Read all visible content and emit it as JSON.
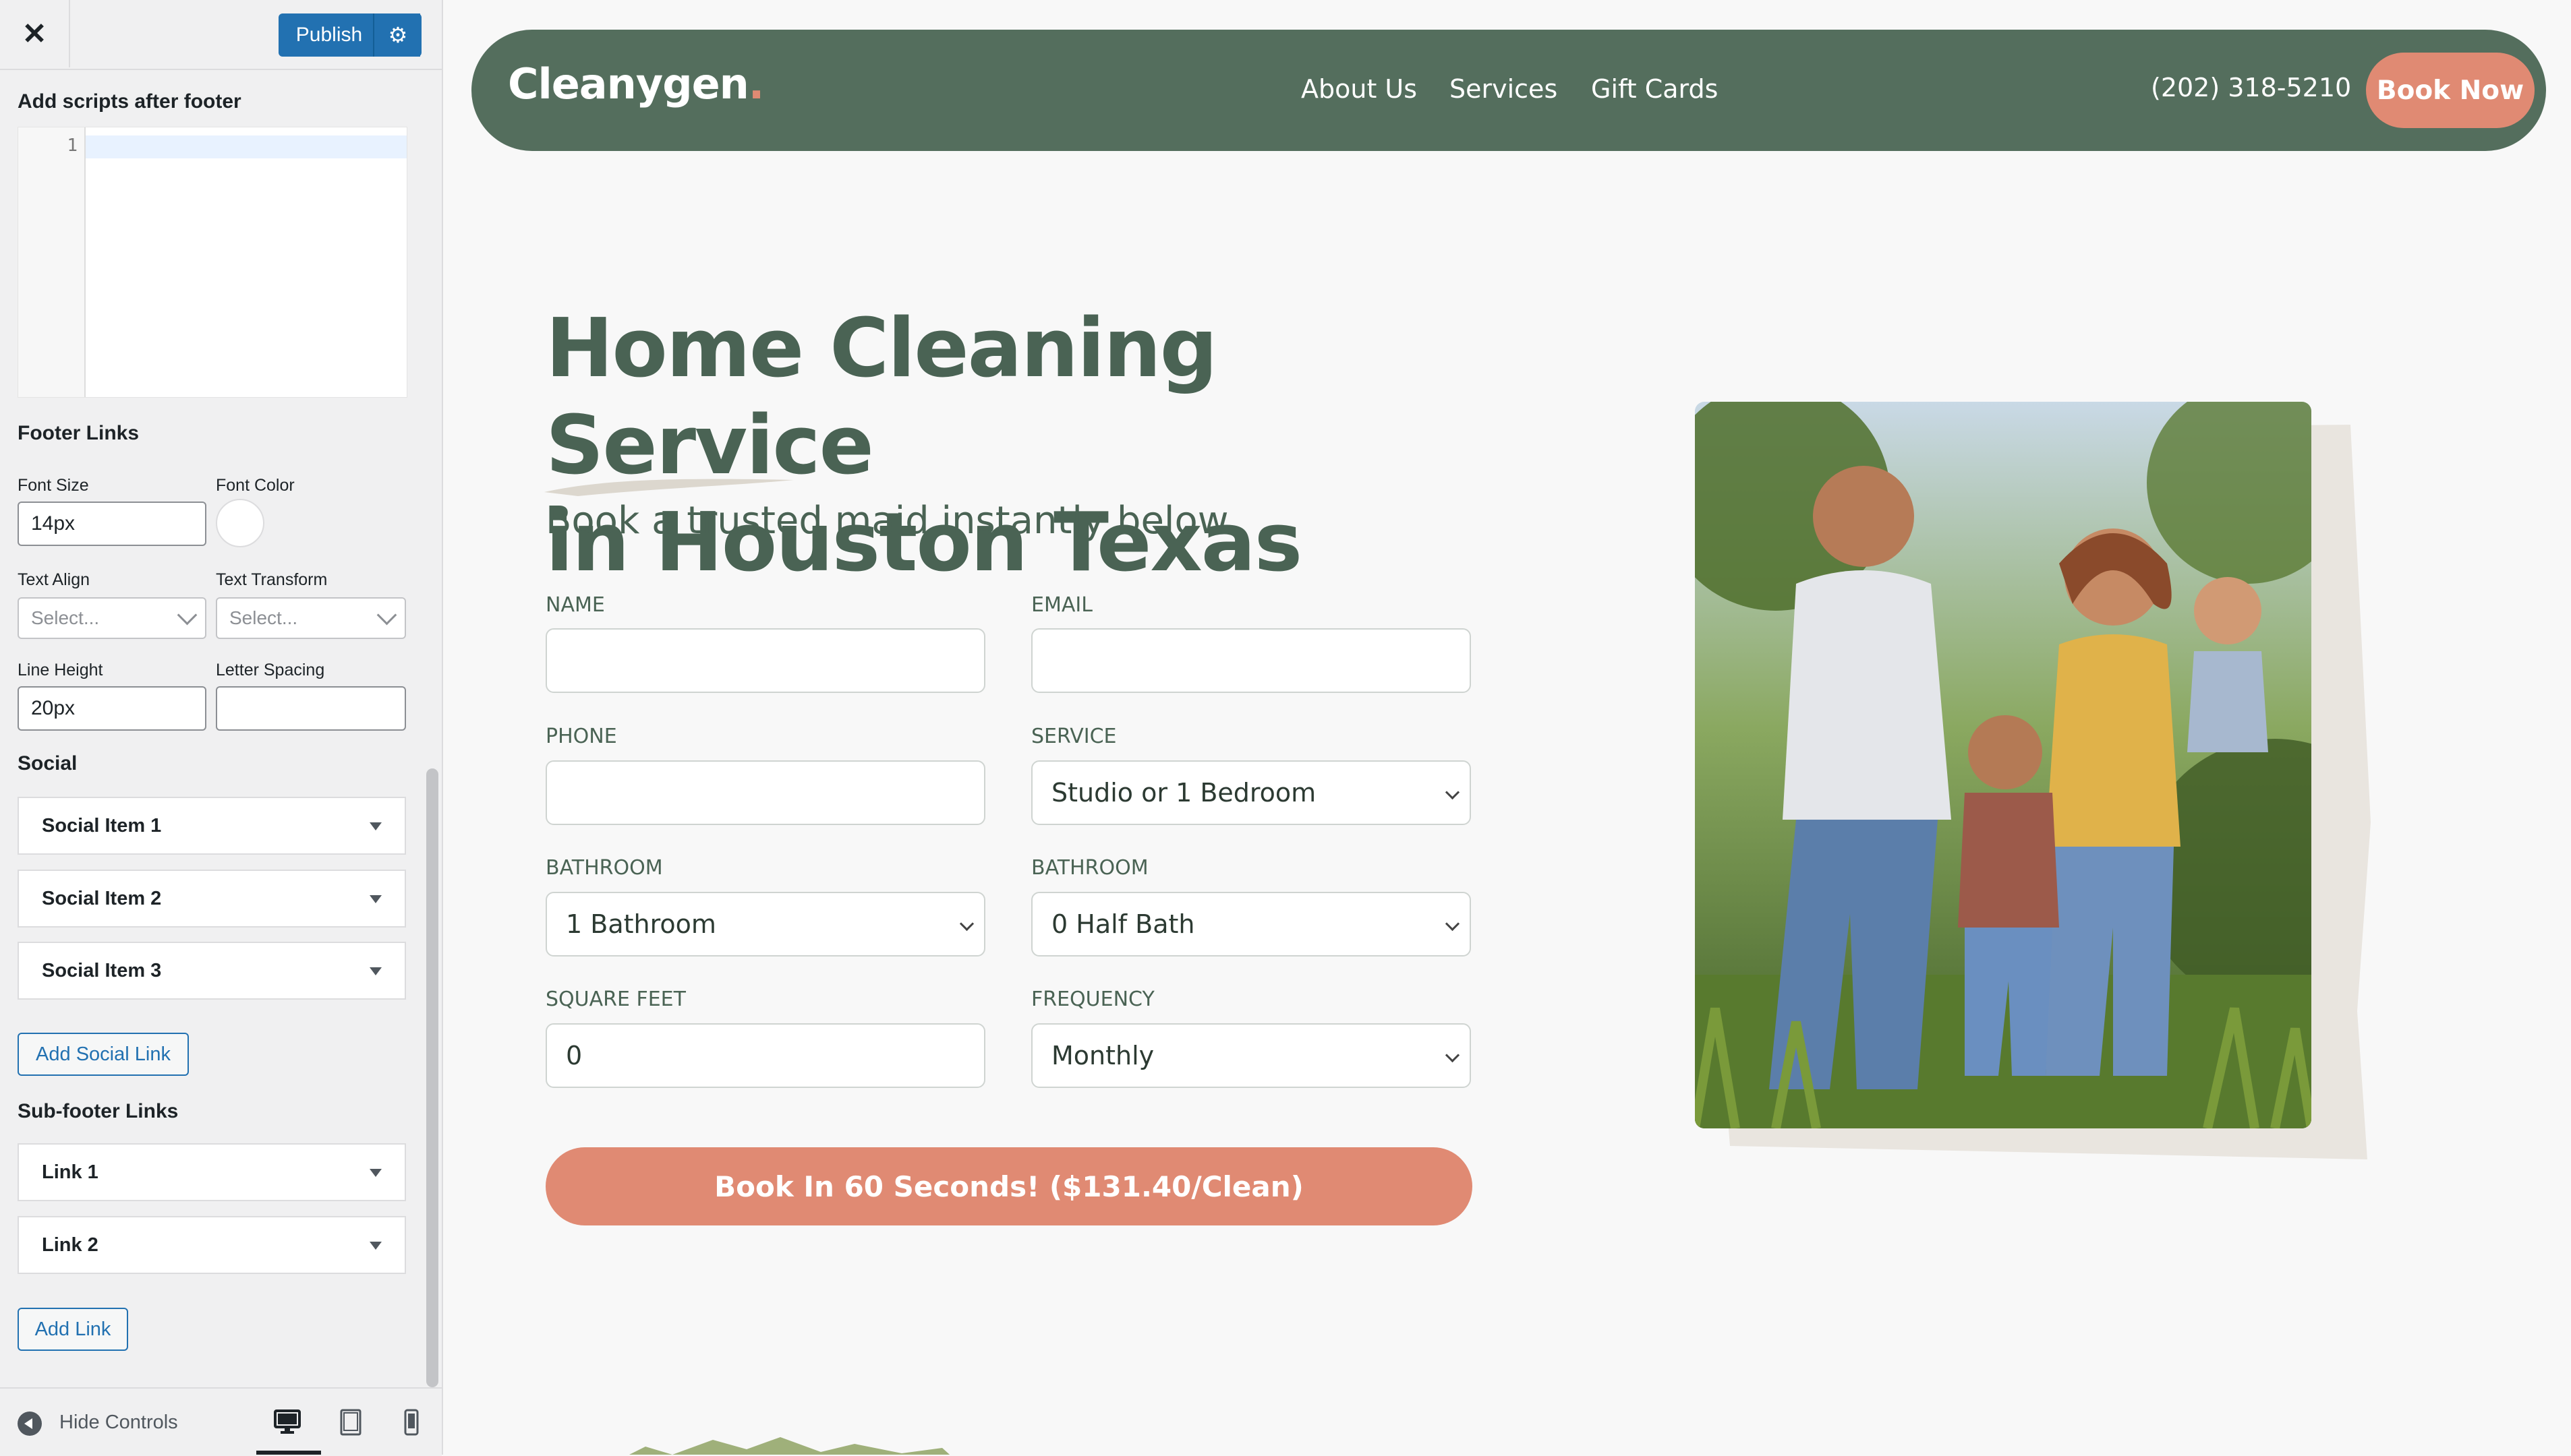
{
  "customizer": {
    "publish_label": "Publish",
    "scripts_after_footer_label": "Add scripts after footer",
    "code_line_number": "1",
    "footer_links_heading": "Footer Links",
    "font_size_label": "Font Size",
    "font_size_value": "14px",
    "font_color_label": "Font Color",
    "text_align_label": "Text Align",
    "text_align_placeholder": "Select...",
    "text_transform_label": "Text Transform",
    "text_transform_placeholder": "Select...",
    "line_height_label": "Line Height",
    "line_height_value": "20px",
    "letter_spacing_label": "Letter Spacing",
    "letter_spacing_value": "",
    "social_heading": "Social",
    "social_items": [
      "Social Item 1",
      "Social Item 2",
      "Social Item 3"
    ],
    "add_social_link_label": "Add Social Link",
    "subfooter_heading": "Sub-footer Links",
    "subfooter_items": [
      "Link 1",
      "Link 2"
    ],
    "add_link_label": "Add Link",
    "hide_controls_label": "Hide Controls"
  },
  "site": {
    "logo": "Cleanygen",
    "logo_dot": ".",
    "nav_links": [
      "About Us",
      "Services",
      "Gift Cards"
    ],
    "phone": "(202) 318-5210",
    "cta": "Book Now",
    "hero_title_line1": "Home Cleaning Service",
    "hero_title_line2": "in Houston Texas",
    "hero_subtitle": "Book a trusted maid instantly below",
    "form": {
      "name_label": "NAME",
      "email_label": "EMAIL",
      "phone_label": "PHONE",
      "service_label": "SERVICE",
      "service_value": "Studio or 1 Bedroom",
      "bathroom_label": "BATHROOM",
      "bathroom_value": "1 Bathroom",
      "half_bath_label": "BATHROOM",
      "half_bath_value": "0 Half Bath",
      "sqft_label": "SQUARE FEET",
      "sqft_value": "0",
      "frequency_label": "FREQUENCY",
      "frequency_value": "Monthly",
      "submit_label": "Book In 60 Seconds! ($131.40/Clean)"
    }
  },
  "colors": {
    "nav_green": "#546e5d",
    "heading_green": "#4a6354",
    "accent_salmon": "#e08a73",
    "wp_blue": "#2271b1"
  },
  "icons": {
    "close": "close-icon",
    "publish_settings": "gear-icon",
    "hide_controls": "arrow-left-circle-icon",
    "devices": [
      "desktop-icon",
      "tablet-icon",
      "mobile-icon"
    ]
  }
}
